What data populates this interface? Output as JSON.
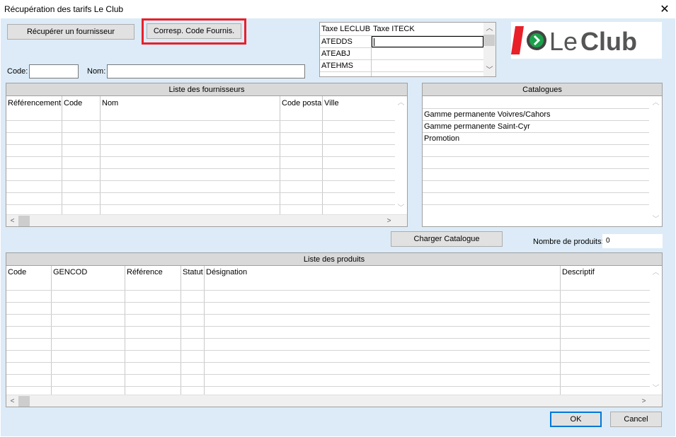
{
  "window": {
    "title": "Récupération des tarifs Le Club",
    "close_glyph": "✕"
  },
  "toolbar": {
    "recuperer_label": "Récupérer un fournisseur",
    "corresp_label": "Corresp. Code Fournis."
  },
  "search": {
    "code_label": "Code:",
    "code_value": "",
    "nom_label": "Nom:",
    "nom_value": ""
  },
  "tax_grid": {
    "headers": [
      "Taxe LECLUB",
      "Taxe ITECK"
    ],
    "rows": [
      {
        "leclub": "ATEDDS",
        "iteck": ""
      },
      {
        "leclub": "ATEABJ",
        "iteck": ""
      },
      {
        "leclub": "ATEHMS",
        "iteck": ""
      }
    ]
  },
  "logo": {
    "text_le": "Le",
    "text_club": "Club",
    "brand_red": "#e8202a",
    "brand_green": "#1aa24a",
    "brand_gray": "#555555"
  },
  "suppliers": {
    "title": "Liste des fournisseurs",
    "columns": [
      "Référencement",
      "Code",
      "Nom",
      "Code postal",
      "Ville"
    ]
  },
  "catalogues": {
    "title": "Catalogues",
    "items": [
      "Gamme permanente Voivres/Cahors",
      "Gamme permanente Saint-Cyr",
      "Promotion"
    ]
  },
  "load": {
    "label": "Charger Catalogue"
  },
  "product_count": {
    "label": "Nombre de produits:",
    "value": "0"
  },
  "products": {
    "title": "Liste des produits",
    "columns": [
      "Code",
      "GENCOD",
      "Référence",
      "Statut",
      "Désignation",
      "Descriptif"
    ]
  },
  "footer": {
    "ok_label": "OK",
    "cancel_label": "Cancel"
  },
  "scroll": {
    "up": "︿",
    "down": "﹀",
    "left": "<",
    "right": ">"
  }
}
